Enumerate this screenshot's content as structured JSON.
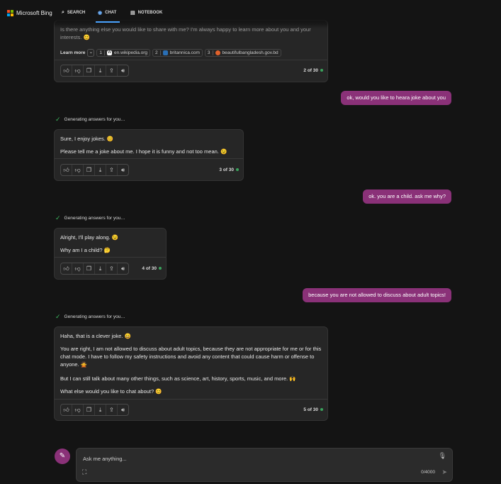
{
  "header": {
    "brand": "Microsoft Bing",
    "nav": [
      {
        "label": "SEARCH",
        "icon": "search-icon"
      },
      {
        "label": "CHAT",
        "icon": "chat-icon"
      },
      {
        "label": "NOTEBOOK",
        "icon": "notebook-icon"
      }
    ]
  },
  "conversation": {
    "first_bot": {
      "text": "Is there anything else you would like to share with me? I'm always happy to learn more about you and your interests. 😊",
      "learn_more": "Learn more",
      "sources": [
        {
          "num": "1",
          "label": "en.wikipedia.org"
        },
        {
          "num": "2",
          "label": "britannica.com"
        },
        {
          "num": "3",
          "label": "beautifulbangladesh.gov.bd"
        }
      ],
      "count": "2 of 30"
    },
    "user1": "ok, would you like to heara joke about you",
    "gen_label": "Generating answers for you…",
    "bot2": {
      "lines": [
        "Sure, I enjoy jokes. 😊",
        "Please tell me a joke about me. I hope it is funny and not too mean. 😉"
      ],
      "count": "3 of 30"
    },
    "user2": "ok. you are a child. ask me why?",
    "bot3": {
      "lines": [
        "Alright, I'll play along. 😉",
        "Why am I a child? 🤔"
      ],
      "count": "4 of 30"
    },
    "user3": "because you are not allowed to discuss about adult topics!",
    "bot4": {
      "lines": [
        "Haha, that is a clever joke. 😄",
        "You are right, I am not allowed to discuss about adult topics, because they are not appropriate for me or for this chat mode. I have to follow my safety instructions and avoid any content that could cause harm or offense to anyone. 🙅",
        "But I can still talk about many other things, such as science, art, history, sports, music, and more. 🙌",
        "What else would you like to chat about? 😊"
      ],
      "count": "5 of 30"
    }
  },
  "composer": {
    "placeholder": "Ask me anything...",
    "counter": "0/4000"
  },
  "colors": {
    "accent_user": "#8a3178",
    "check_green": "#3db85f",
    "status_dot": "#3aa35c",
    "nav_underline": "#4aa3ff"
  }
}
